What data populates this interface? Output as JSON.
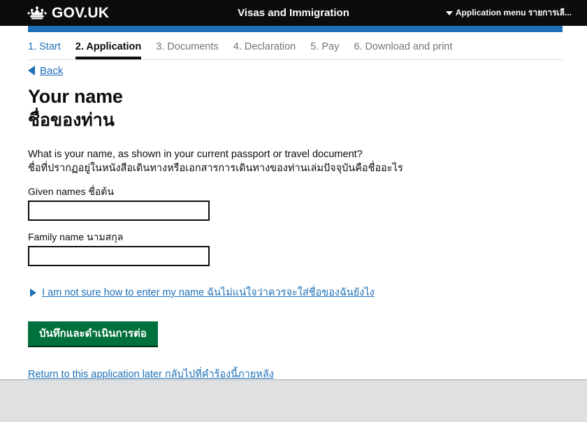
{
  "header": {
    "crown_icon": "crown-icon",
    "brand": "GOV.UK",
    "service_title": "Visas and Immigration",
    "menu_caret_icon": "chevron-down-icon",
    "menu_label": "Application menu รายการเลื..."
  },
  "steps": [
    {
      "label": "1. Start",
      "state": "link"
    },
    {
      "label": "2. Application",
      "state": "active"
    },
    {
      "label": "3. Documents",
      "state": "disabled"
    },
    {
      "label": "4. Declaration",
      "state": "disabled"
    },
    {
      "label": "5. Pay",
      "state": "disabled"
    },
    {
      "label": "6. Download and print",
      "state": "disabled"
    }
  ],
  "back": {
    "icon": "triangle-left-icon",
    "label": "Back"
  },
  "page": {
    "title_en": "Your name",
    "title_th": "ชื่อของท่าน",
    "question_en": "What is your name, as shown in your current passport or travel document?",
    "question_th": "ชื่อที่ปรากฏอยู่ในหนังสือเดินทางหรือเอกสารการเดินทางของท่านเล่มปัจจุบันคือชื่ออะไร"
  },
  "fields": {
    "given_names": {
      "label": "Given names ชื่อต้น",
      "value": "",
      "placeholder": ""
    },
    "family_name": {
      "label": "Family name นามสกุล",
      "value": "",
      "placeholder": ""
    }
  },
  "details": {
    "icon": "triangle-right-icon",
    "label": "I am not sure how to enter my name ฉันไม่แน่ใจว่าควรจะใส่ชื่อของฉันยังไง"
  },
  "actions": {
    "submit_label": "บันทึกและดำเนินการต่อ",
    "return_link_label": "Return to this application later กลับไปที่คำร้องนี้ภายหลัง"
  },
  "colors": {
    "header_black": "#0b0c0c",
    "gov_blue": "#1d70b8",
    "green_button": "#00703c",
    "footer_grey": "#dee0e2",
    "muted_grey": "#6f777b"
  }
}
